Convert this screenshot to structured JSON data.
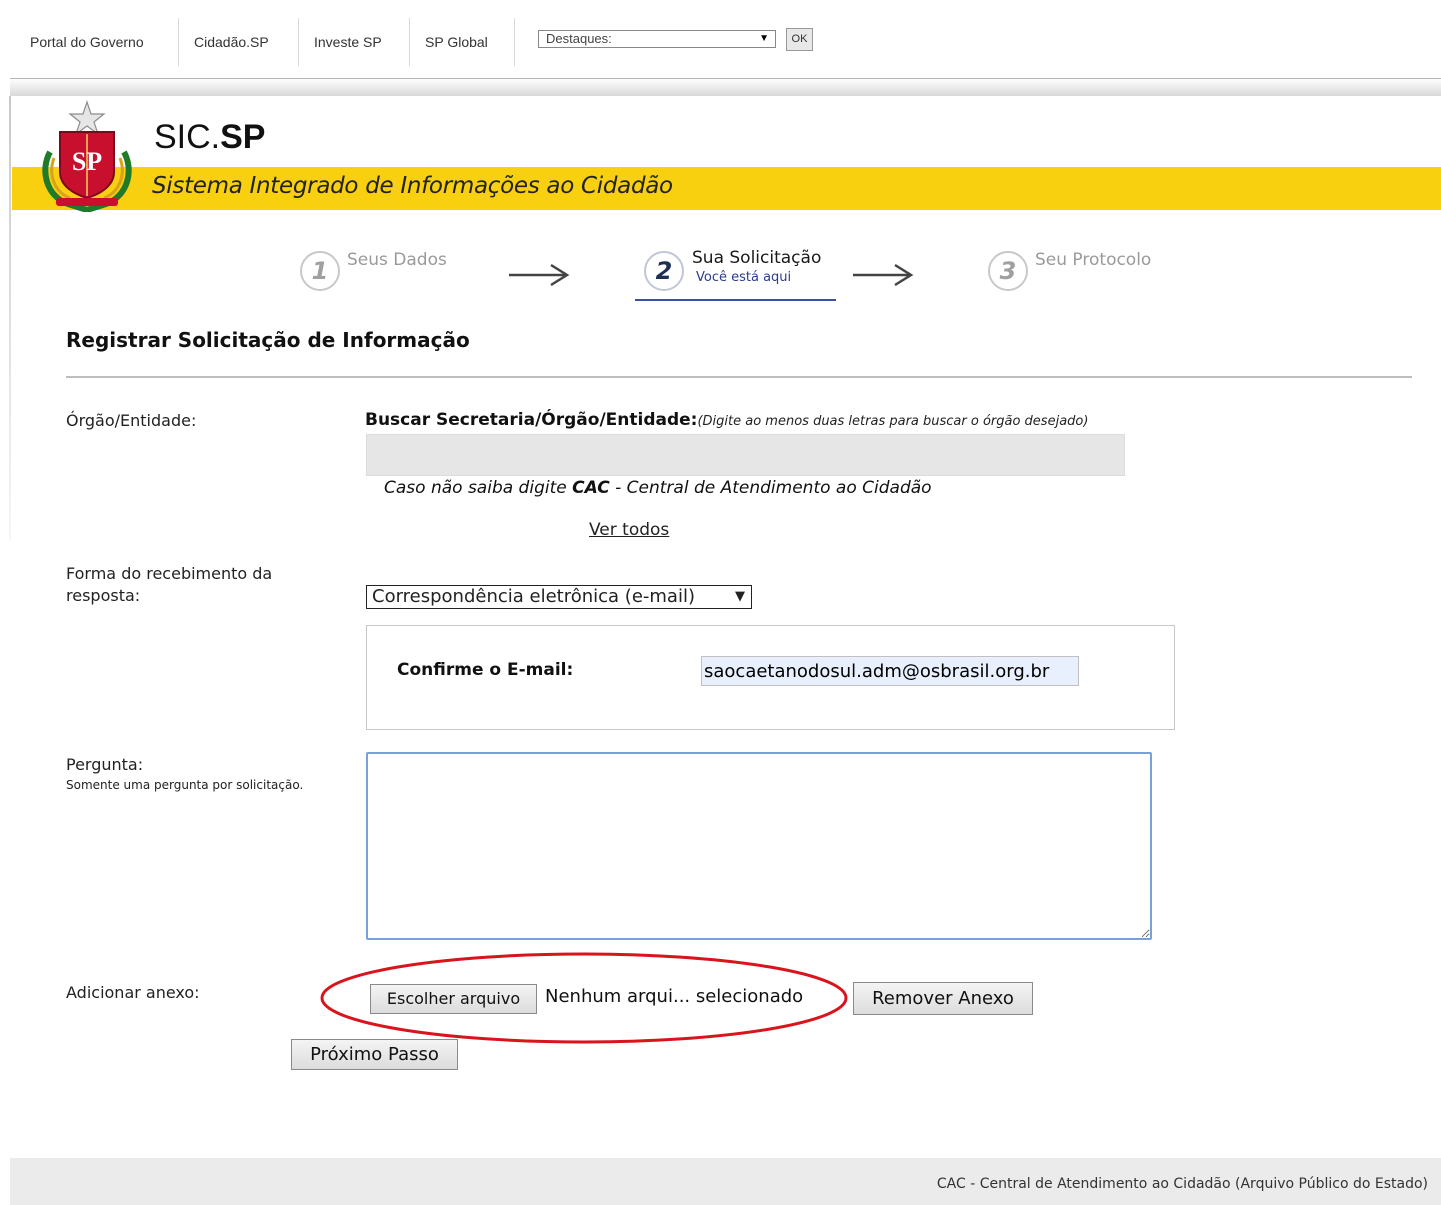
{
  "topbar": {
    "links": [
      "Portal do Governo",
      "Cidadão.SP",
      "Investe SP",
      "SP Global"
    ],
    "destaques_select": "Destaques:",
    "ok_button": "OK"
  },
  "header": {
    "brand_prefix": "SIC.",
    "brand_suffix": "SP",
    "tagline": "Sistema Integrado de Informações ao Cidadão",
    "logo_letters": "SP"
  },
  "steps": [
    {
      "number": "1",
      "label": "Seus Dados",
      "active": false
    },
    {
      "number": "2",
      "label": "Sua Solicitação",
      "sublabel": "Você está aqui",
      "active": true
    },
    {
      "number": "3",
      "label": "Seu Protocolo",
      "active": false
    }
  ],
  "form": {
    "title": "Registrar Solicitação de Informação",
    "orgao_label": "Órgão/Entidade:",
    "buscar_label": "Buscar Secretaria/Órgão/Entidade:",
    "buscar_hint": "(Digite ao menos duas letras para buscar o órgão desejado)",
    "search_value": "",
    "cac_hint_pre": "Caso não saiba digite ",
    "cac_hint_bold": "CAC",
    "cac_hint_post": " - Central de Atendimento ao Cidadão",
    "ver_todos": "Ver todos",
    "forma_label": "Forma do recebimento da resposta:",
    "forma_selected": "Correspondência eletrônica (e-mail)",
    "confirm_email_label": "Confirme o E-mail:",
    "confirm_email_value": "saocaetanodosul.adm@osbrasil.org.br",
    "pergunta_label": "Pergunta:",
    "pergunta_sub": "Somente uma pergunta por solicitação.",
    "pergunta_value": "",
    "anexo_label": "Adicionar anexo:",
    "file_button": "Escolher arquivo",
    "file_status": "Nenhum arqui... selecionado",
    "remove_button": "Remover Anexo",
    "next_button": "Próximo Passo"
  },
  "footer": {
    "text": "CAC - Central de Atendimento ao Cidadão (Arquivo Público do Estado)"
  },
  "colors": {
    "band_yellow": "#f8d00f",
    "highlight_ellipse": "#d9141c",
    "active_step_underline": "#3a4fa8"
  }
}
